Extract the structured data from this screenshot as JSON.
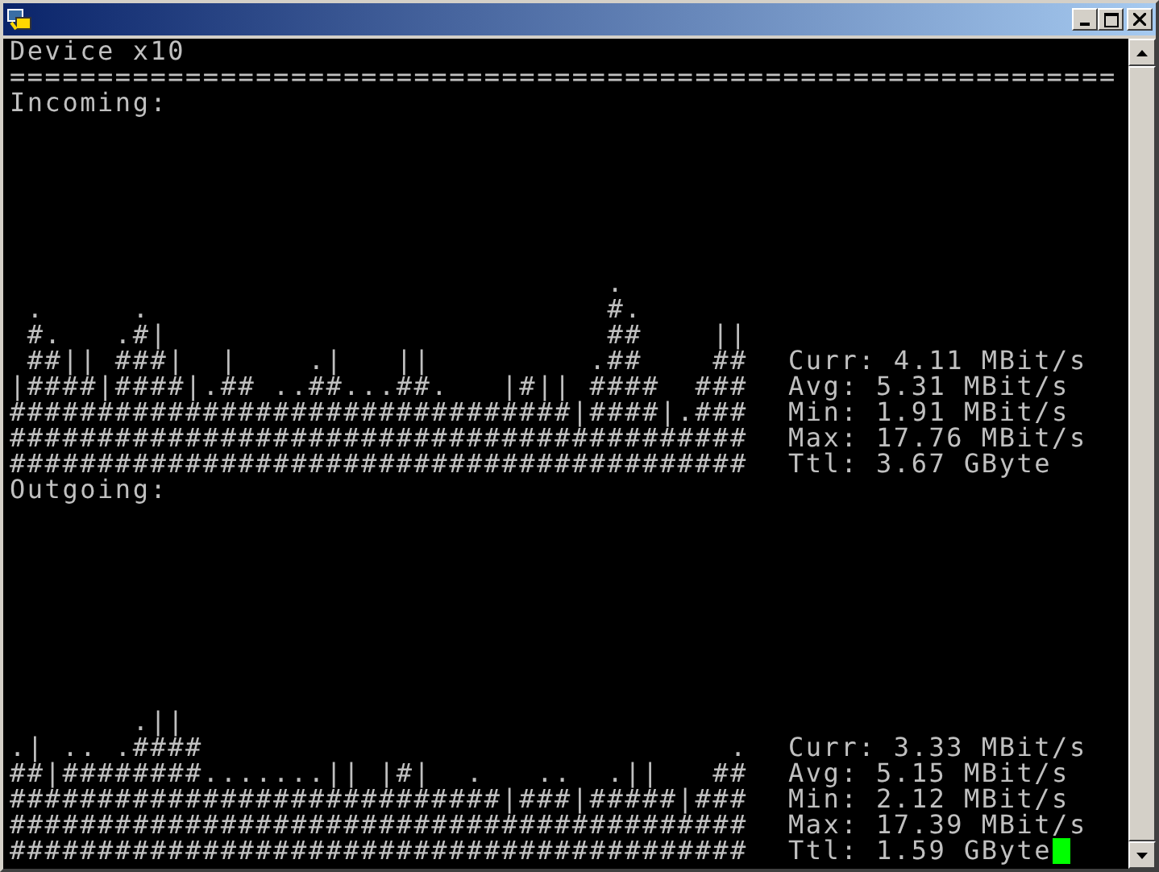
{
  "terminal": {
    "header": "Device x10",
    "separator": "===============================================================",
    "cursor": true,
    "sections": [
      {
        "label": "Incoming:",
        "graph_rows": [
          "                                  .",
          " .     .                          #.",
          " #.   .#|                         ##    ||",
          " ##|| ###|  |    .|   ||         .##    ##",
          "|####|####|.## ..##...##.   |#|| ####  ###",
          "################################|####|.###",
          "##########################################",
          "##########################################"
        ],
        "stats": [
          "Curr: 4.11 MBit/s",
          "Avg: 5.31 MBit/s",
          "Min: 1.91 MBit/s",
          "Max: 17.76 MBit/s",
          "Ttl: 3.67 GByte"
        ]
      },
      {
        "label": "Outgoing:",
        "graph_rows": [
          "       .||",
          ".| .. .####                              .",
          "##|########.......|| |#|  .   ..  .||   ##",
          "############################|###|#####|###",
          "##########################################",
          "##########################################"
        ],
        "stats": [
          "Curr: 3.33 MBit/s",
          "Avg: 5.15 MBit/s",
          "Min: 2.12 MBit/s",
          "Max: 17.39 MBit/s",
          "Ttl: 1.59 GByte"
        ]
      }
    ]
  }
}
